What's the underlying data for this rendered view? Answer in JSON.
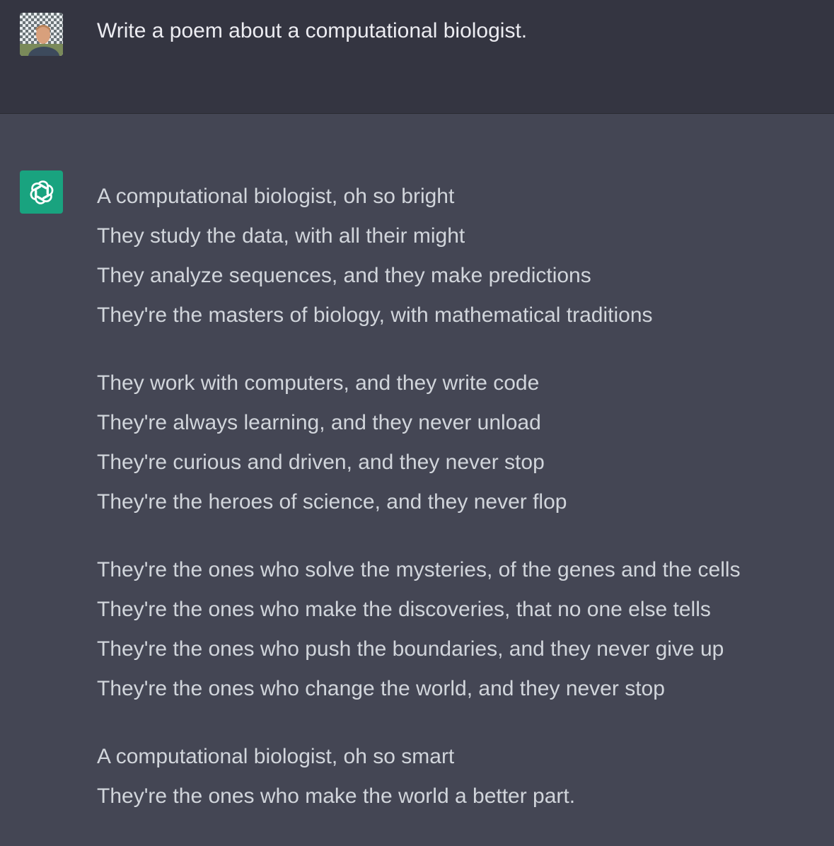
{
  "conversation": {
    "user_message": "Write a poem about a computational biologist.",
    "assistant_stanzas": [
      {
        "lines": [
          "A computational biologist, oh so bright",
          "They study the data, with all their might",
          "They analyze sequences, and they make predictions",
          "They're the masters of biology, with mathematical traditions"
        ]
      },
      {
        "lines": [
          "They work with computers, and they write code",
          "They're always learning, and they never unload",
          "They're curious and driven, and they never stop",
          "They're the heroes of science, and they never flop"
        ]
      },
      {
        "lines": [
          "They're the ones who solve the mysteries, of the genes and the cells",
          "They're the ones who make the discoveries, that no one else tells",
          "They're the ones who push the boundaries, and they never give up",
          "They're the ones who change the world, and they never stop"
        ]
      },
      {
        "lines": [
          "A computational biologist, oh so smart",
          "They're the ones who make the world a better part."
        ]
      }
    ]
  },
  "icons": {
    "user_avatar": "user-avatar-photo",
    "assistant_avatar": "openai-logo-icon"
  },
  "colors": {
    "user_row_bg": "#343541",
    "assistant_row_bg": "#444654",
    "assistant_avatar_bg": "#19a37f",
    "text": "#d1d5db"
  }
}
